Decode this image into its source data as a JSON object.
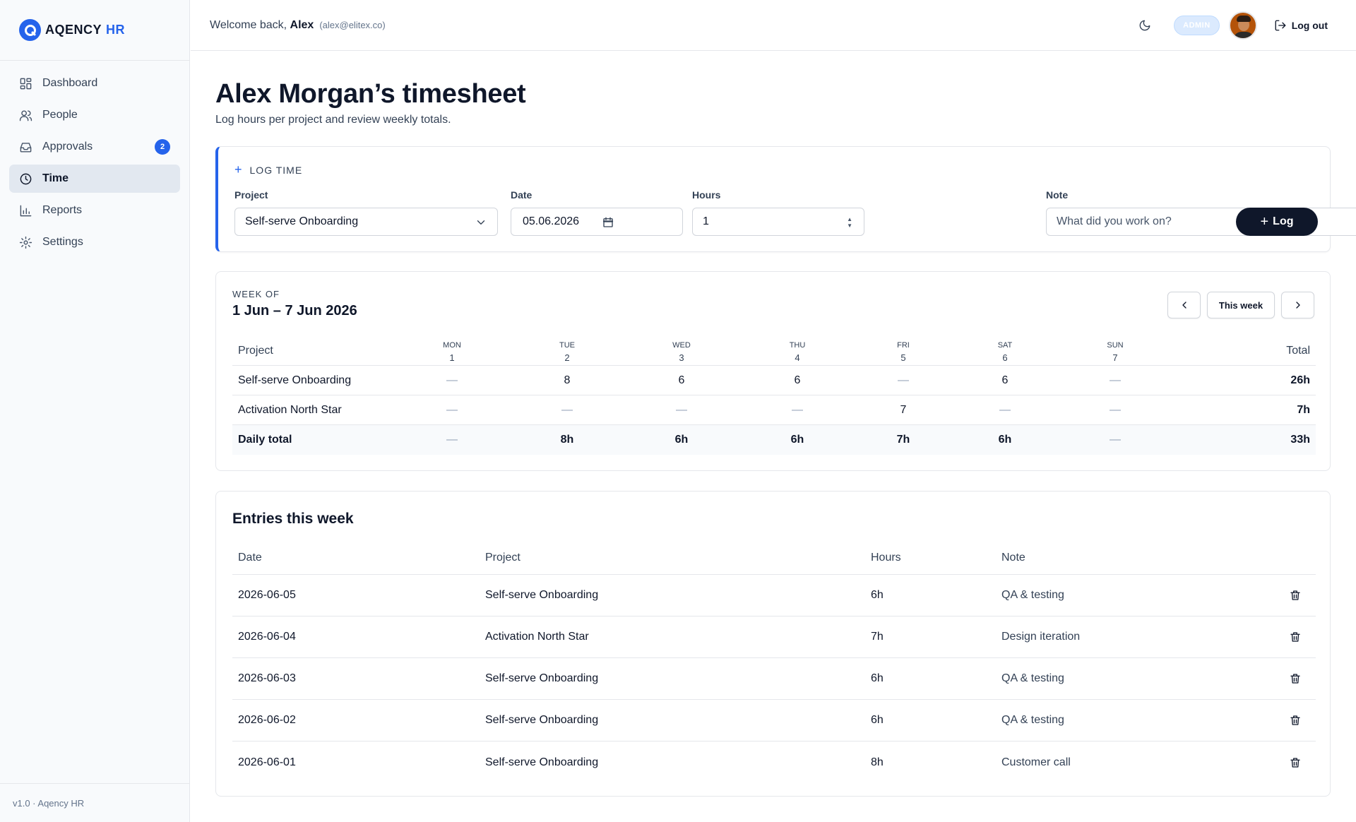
{
  "brand": {
    "name": "AQENCY",
    "accent": "HR",
    "color": "#2563eb"
  },
  "sidebar": {
    "items": [
      {
        "label": "Dashboard",
        "icon": "dashboard-icon"
      },
      {
        "label": "People",
        "icon": "people-icon"
      },
      {
        "label": "Approvals",
        "icon": "inbox-icon",
        "badge": "2"
      },
      {
        "label": "Time",
        "icon": "clock-icon",
        "active": true
      },
      {
        "label": "Reports",
        "icon": "bar-chart-icon"
      },
      {
        "label": "Settings",
        "icon": "gear-icon"
      }
    ],
    "footer": "v1.0 · Aqency HR"
  },
  "topbar": {
    "welcome_prefix": "Welcome back,",
    "user_name": "Alex",
    "user_email": "(alex@elitex.co)",
    "role": "ADMIN",
    "logout_label": "Log out"
  },
  "page": {
    "title": "Alex Morgan’s timesheet",
    "subtitle": "Log hours per project and review weekly totals."
  },
  "log_time": {
    "heading": "LOG TIME",
    "project_label": "Project",
    "project_value": "Self-serve Onboarding",
    "date_label": "Date",
    "date_value": "05.06.2026",
    "hours_label": "Hours",
    "hours_value": "1",
    "note_label": "Note",
    "note_placeholder": "What did you work on?",
    "submit_label": "Log"
  },
  "week": {
    "label": "WEEK OF",
    "range": "1 Jun – 7 Jun 2026",
    "this_week_label": "This week",
    "project_header": "Project",
    "total_header": "Total",
    "days": [
      {
        "name": "MON",
        "num": "1"
      },
      {
        "name": "TUE",
        "num": "2"
      },
      {
        "name": "WED",
        "num": "3"
      },
      {
        "name": "THU",
        "num": "4"
      },
      {
        "name": "FRI",
        "num": "5"
      },
      {
        "name": "SAT",
        "num": "6"
      },
      {
        "name": "SUN",
        "num": "7"
      }
    ],
    "rows": [
      {
        "project": "Self-serve Onboarding",
        "cells": [
          "—",
          "8",
          "6",
          "6",
          "—",
          "6",
          "—"
        ],
        "total": "26h"
      },
      {
        "project": "Activation North Star",
        "cells": [
          "—",
          "—",
          "—",
          "—",
          "7",
          "—",
          "—"
        ],
        "total": "7h"
      }
    ],
    "daily_total": {
      "label": "Daily total",
      "cells": [
        "—",
        "8h",
        "6h",
        "6h",
        "7h",
        "6h",
        "—"
      ],
      "total": "33h"
    }
  },
  "entries": {
    "title": "Entries this week",
    "columns": [
      "Date",
      "Project",
      "Hours",
      "Note"
    ],
    "rows": [
      {
        "date": "2026-06-05",
        "project": "Self-serve Onboarding",
        "hours": "6h",
        "note": "QA & testing"
      },
      {
        "date": "2026-06-04",
        "project": "Activation North Star",
        "hours": "7h",
        "note": "Design iteration"
      },
      {
        "date": "2026-06-03",
        "project": "Self-serve Onboarding",
        "hours": "6h",
        "note": "QA & testing"
      },
      {
        "date": "2026-06-02",
        "project": "Self-serve Onboarding",
        "hours": "6h",
        "note": "QA & testing"
      },
      {
        "date": "2026-06-01",
        "project": "Self-serve Onboarding",
        "hours": "8h",
        "note": "Customer call"
      }
    ]
  }
}
